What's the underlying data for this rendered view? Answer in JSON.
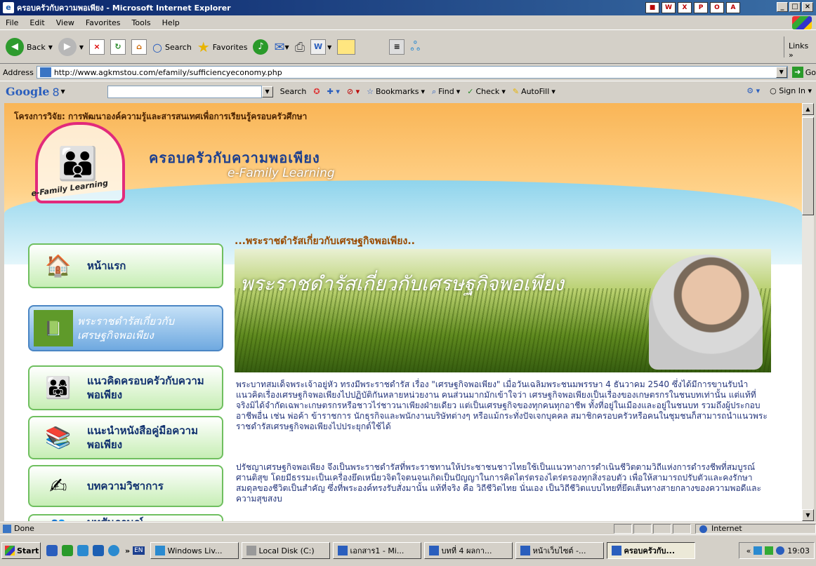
{
  "window": {
    "title": "ครอบครัวกับความพอเพียง - Microsoft Internet Explorer"
  },
  "menu": [
    "File",
    "Edit",
    "View",
    "Favorites",
    "Tools",
    "Help"
  ],
  "toolbar": {
    "back": "Back",
    "search": "Search",
    "favorites": "Favorites",
    "links": "Links"
  },
  "address": {
    "label": "Address",
    "url": "http://www.agkmstou.com/efamily/sufficiencyeconomy.php",
    "go": "Go"
  },
  "google": {
    "logo": "Google",
    "selector": "8",
    "search": "Search",
    "bookmarks": "Bookmarks",
    "find": "Find",
    "check": "Check",
    "autofill": "AutoFill",
    "signin": "Sign In"
  },
  "page": {
    "project": "โครงการวิจัย: การพัฒนาองค์ความรู้และสารสนเทศเพื่อการเรียนรู้ครอบครัวศึกษา",
    "logo_text": "e-Family Learning",
    "site_title": "ครอบครัวกับความพอเพียง",
    "site_subtitle": "e-Family Learning",
    "nav": [
      {
        "label": "หน้าแรก"
      },
      {
        "label": "พระราชดำรัสเกี่ยวกับเศรษฐกิจพอเพียง"
      },
      {
        "label": "แนวคิดครอบครัวกับความพอเพียง"
      },
      {
        "label": "แนะนำหนังสือคู่มือความพอเพียง"
      },
      {
        "label": "บทความวิชาการ"
      },
      {
        "label": "บทสัมภาษณ์"
      }
    ],
    "heading": "...พระราชดำรัสเกี่ยวกับเศรษฐกิจพอเพียง..",
    "banner_title": "พระราชดำรัสเกี่ยวกับเศรษฐกิจพอเพียง",
    "para1": "พระบาทสมเด็จพระเจ้าอยู่หัว ทรงมีพระราชดำรัส เรื่อง \"เศรษฐกิจพอเพียง\" เมื่อวันเฉลิมพระชนมพรรษา 4 ธันวาคม 2540 ซึ่งได้มีการขานรับนำแนวคิดเรื่องเศรษฐกิจพอเพียงไปปฏิบัติกันหลายหน่วยงาน คนส่วนมากมักเข้าใจว่า เศรษฐกิจพอเพียงเป็นเรื่องของเกษตรกรในชนบทเท่านั้น แต่แท้ที่จริงมิได้จำกัดเฉพาะเกษตรกรหรือชาวไร่ชาวนาเพียงฝ่ายเดียว แต่เป็นเศรษฐกิจของทุกคนทุกอาชีพ ทั้งที่อยู่ในเมืองและอยู่ในชนบท รวมถึงผู้ประกอบอาชีพอื่น เช่น พ่อค้า ข้าราชการ นักธุรกิจและพนักงานบริษัทต่างๆ หรือแม้กระทั่งปัจเจกบุคคล สมาชิกครอบครัวหรือคนในชุมชนก็สามารถนำแนวพระราชดำรัสเศรษฐกิจพอเพียงไปประยุกต์ใช้ได้",
    "para2": "ปรัชญาเศรษฐกิจพอเพียง จึงเป็นพระราชดำรัสที่พระราชทานให้ประชาชนชาวไทยใช้เป็นแนวทางการดำเนินชีวิตตามวิถีแห่งการดำรงชีพที่สมบูรณ์ ศานติสุข โดยมีธรรมะเป็นเครื่องยึดเหนี่ยวจิตใจตนจนเกิดเป็นปัญญาในการคิดไตร่ตรองไตร่ตรองทุกสิ่งรอบตัว เพื่อให้สามารถปรับตัวและคงรักษาสมดุลของชีวิตเป็นสำคัญ ซึ่งที่พระองค์ทรงรับสั่งมานั้น แท้ที่จริง คือ วิถีชีวิตไทย นั่นเอง เป็นวิถีชีวิตแบบไทยที่ยึดเส้นทางสายกลางของความพอดีและความสุขสงบ"
  },
  "status": {
    "text": "Done",
    "zone": "Internet"
  },
  "taskbar": {
    "start": "Start",
    "lang": "EN",
    "tasks": [
      "Windows Liv...",
      "Local Disk (C:)",
      "เอกสาร1 - Mi...",
      "บทที่ 4 ผลกา...",
      "หน้าเว็บไซต์ -...",
      "ครอบครัวกับ..."
    ],
    "clock": "19:03"
  }
}
